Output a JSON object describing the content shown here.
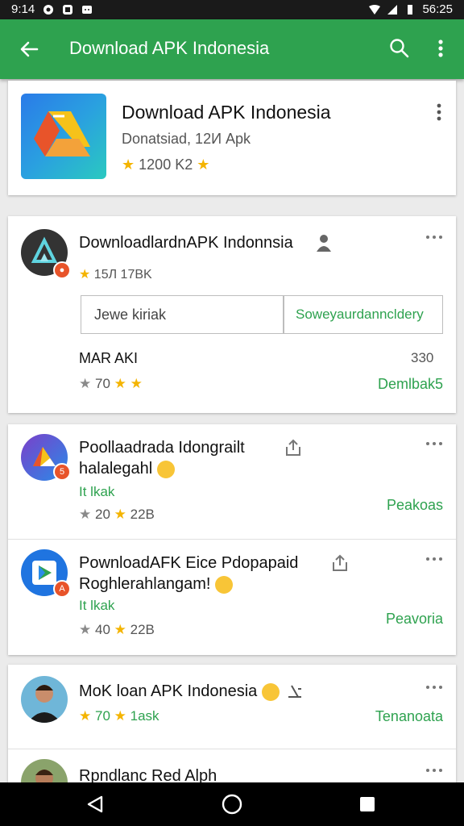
{
  "status_bar": {
    "time_left": "9:14",
    "time_right": "56:25"
  },
  "app_bar": {
    "title": "Download APK Indonesia"
  },
  "header_card": {
    "name": "Download APK Indonesia",
    "subtitle": "Donatsiad, 12И Apk",
    "rating": "1200 K2"
  },
  "card1": {
    "name": "DownloadlardnAPK Indonnsia",
    "rating": "15Л 17BK",
    "button_left": "Jewe kiriak",
    "button_right": "Soweyaurdanncldery",
    "label": "MAR AKI",
    "count": "330",
    "score": "70",
    "action": "Demlbak5"
  },
  "card2": {
    "item1": {
      "name_line1": "Poollaadrada Idongrailt",
      "name_line2": "halalegahl",
      "tag": "It lkak",
      "score": "20",
      "size": "22B",
      "action": "Peakoas",
      "badge": "5"
    },
    "item2": {
      "name_line1": "PownloadAFK Eice Pdopapaid",
      "name_line2": "Roghlerahlangam!",
      "tag": "It lkak",
      "score": "40",
      "size": "22B",
      "action": "Peavoria",
      "badge": "A"
    }
  },
  "card3": {
    "item1": {
      "name": "MoK loan APK Indonesia",
      "score": "70",
      "tag": "1ask",
      "action": "Tenanoata"
    },
    "item2": {
      "name": "Rpndlanc Red Alph"
    }
  },
  "colors": {
    "appbar": "#2ea24f",
    "accent_green": "#2ea24f",
    "star": "#f4b400"
  }
}
